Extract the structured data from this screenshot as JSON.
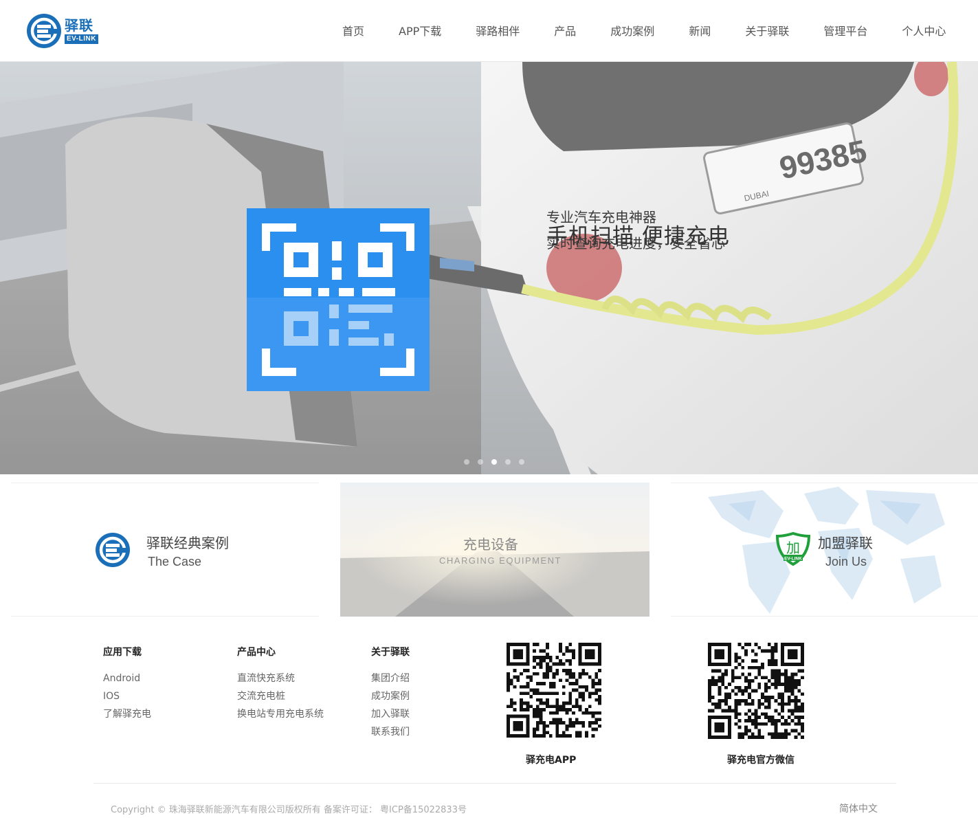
{
  "brand": {
    "name_cn": "驿联",
    "name_en": "EV-LINK",
    "accent": "#1a6fb8"
  },
  "nav": {
    "items": [
      "首页",
      "APP下载",
      "驿路相伴",
      "产品",
      "成功案例",
      "新闻",
      "关于驿联",
      "管理平台",
      "个人中心"
    ]
  },
  "banner": {
    "title": "手机扫描  便捷充电",
    "line1": "专业汽车充电神器",
    "line2": "实时查询充电进度，安全省心",
    "plate": "99385",
    "plate_city": "DUBAI",
    "slide_count": 5,
    "active_slide": 3,
    "icon": "qr-scan-icon",
    "icon_color": "#2b8ff0"
  },
  "cards": {
    "case": {
      "title": "驿联经典案例",
      "subtitle": "The Case"
    },
    "equipment": {
      "title": "充电设备",
      "subtitle": "CHARGING EQUIPMENT"
    },
    "join": {
      "title": "加盟驿联",
      "subtitle": "Join Us",
      "badge": "加",
      "badge_en": "EV-LINK",
      "badge_color": "#1fa03a"
    }
  },
  "footer": {
    "col1": {
      "title": "应用下载",
      "links": [
        "Android",
        "IOS",
        "了解驿充电"
      ]
    },
    "col2": {
      "title": "产品中心",
      "links": [
        "直流快充系统",
        "交流充电桩",
        "换电站专用充电系统"
      ]
    },
    "col3": {
      "title": "关于驿联",
      "links": [
        "集团介绍",
        "成功案例",
        "加入驿联",
        "联系我们"
      ]
    },
    "qr_app": "驿充电APP",
    "qr_wechat": "驿充电官方微信",
    "copyright": "Copyright © 珠海驿联新能源汽车有限公司版权所有 备案许可证：  粤ICP备15022833号",
    "language": "简体中文"
  }
}
